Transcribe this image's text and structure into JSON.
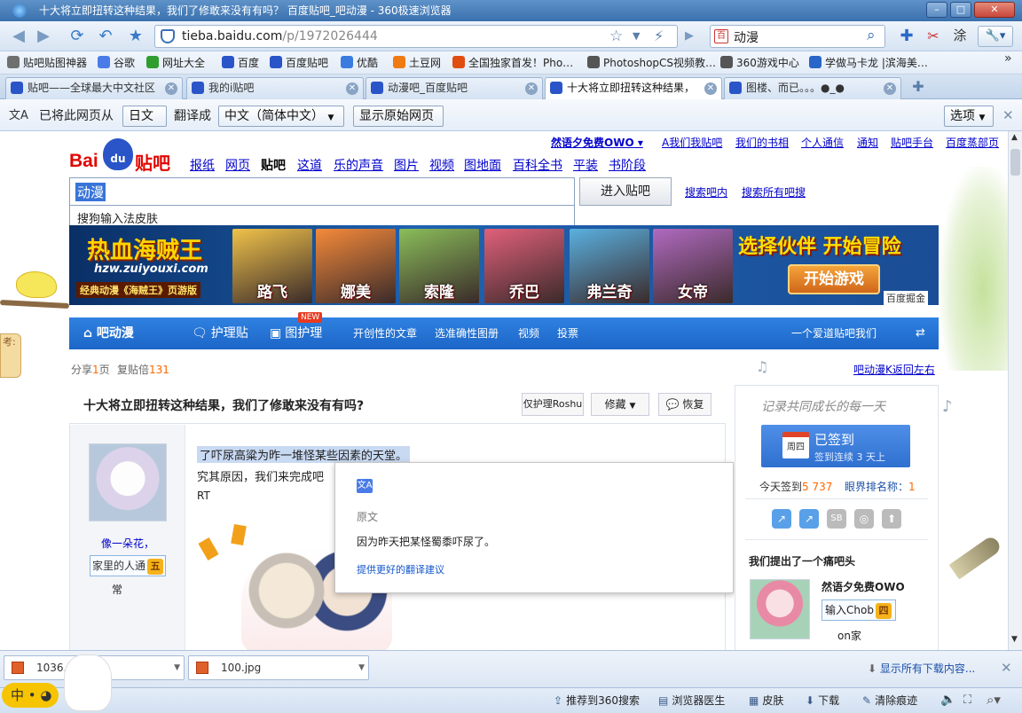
{
  "window": {
    "title": "十大将立即扭转这种结果，我们了修敢来没有有吗？ 百度贴吧_吧动漫 - 360极速浏览器"
  },
  "navbar": {
    "address_host": "tieba.baidu.com",
    "address_path": "/p/1972026444",
    "search_value": "动漫"
  },
  "bookmarks": [
    {
      "label": "贴吧贴图神器",
      "icon": "doc-icon",
      "color": "#6f6f6f"
    },
    {
      "label": "谷歌",
      "icon": "google-icon",
      "color": "#4a7be8"
    },
    {
      "label": "网址大全",
      "icon": "site-nav-icon",
      "color": "#2f9e2f"
    },
    {
      "label": "百度",
      "icon": "baidu-paw-icon",
      "color": "#2a55c8"
    },
    {
      "label": "百度贴吧",
      "icon": "baidu-paw-icon",
      "color": "#2a55c8"
    },
    {
      "label": "优酷",
      "icon": "youku-icon",
      "color": "#3a7be0"
    },
    {
      "label": "土豆网",
      "icon": "tudou-icon",
      "color": "#f07a10"
    },
    {
      "label": "全国独家首发！Pho…",
      "icon": "tmall-icon",
      "color": "#e04d10"
    },
    {
      "label": "PhotoshopCS视频教…",
      "icon": "ps-icon",
      "color": "#555"
    },
    {
      "label": "360游戏中心",
      "icon": "gamepad-icon",
      "color": "#555"
    },
    {
      "label": "学做马卡龙 |滨海美…",
      "icon": "site-icon",
      "color": "#2a65c8"
    }
  ],
  "tabs": [
    {
      "label": "贴吧——全球最大中文社区",
      "active": false
    },
    {
      "label": "我的i贴吧",
      "active": false
    },
    {
      "label": "动漫吧_百度贴吧",
      "active": false
    },
    {
      "label": "十大将立即扭转这种结果，",
      "active": true
    },
    {
      "label": "图楼、而已。。。●_●",
      "active": false
    }
  ],
  "translate_bar": {
    "text1": "已将此网页从",
    "source_lang": "日文",
    "text2": "翻译成",
    "target_lang": "中文（简体中文）",
    "show_original": "显示原始网页",
    "options": "选项"
  },
  "page": {
    "user": "然语夕免费OWO",
    "top_links": [
      "A我们我贴吧",
      "我们的书相",
      "个人通信",
      "通知",
      "贴吧手台",
      "百度蒸部页"
    ],
    "nav_links": [
      "报纸",
      "网页",
      "贴吧",
      "这道",
      "乐的声音",
      "图片",
      "视频",
      "图地面",
      "百科全书",
      "平装",
      "书阶段"
    ],
    "search_value": "动漫",
    "search_suggestion": "搜狗输入法皮肤",
    "enter_button": "进入贴吧",
    "search_in_bar": "搜索吧内",
    "search_all": "搜索所有吧搜",
    "banner": {
      "logo": "热血海贼王",
      "site": "hzw.zuiyouxi.com",
      "subtitle": "经典动漫《海贼王》页游版",
      "chars": [
        "路飞",
        "娜美",
        "索隆",
        "乔巴",
        "弗兰奇",
        "女帝"
      ],
      "slogan": "选择伙伴 开始冒险",
      "start": "开始游戏",
      "sponsor": "百度掘金"
    },
    "bluebar": {
      "home": "吧动漫",
      "items": [
        "护理贴",
        "图护理",
        "开创性的文章",
        "选准确性图册",
        "视频",
        "投票"
      ],
      "new_badge": "NEW",
      "right": "一个爱道贴吧我们"
    },
    "meta": {
      "share_label": "分享",
      "share_count": "1",
      "share_unit": "页",
      "reply_label": "复贴倍",
      "reply_count": "131",
      "back_link": "吧动漫K返回左右"
    },
    "post": {
      "title": "十大将立即扭转这种结果，我们了修敢来没有有吗?",
      "only_owner": "仅护理Roshu",
      "collect": "修藏",
      "reply": "恢复",
      "author": "像一朵花，",
      "author_level_label": "家里的人通",
      "author_level": "五",
      "author_extra": "常",
      "line1": "了吓尿高粱为昨一堆怪某些因素的天堂。",
      "line2": "究其原因，我们来完成吧",
      "line3": "RT"
    },
    "popup": {
      "label": "原文",
      "original": "因为昨天把某怪蜀黍吓尿了。",
      "suggest": "提供更好的翻译建议"
    },
    "sidebar": {
      "motto": "记录共同成长的每一天",
      "sign_day": "周四",
      "sign_title": "已签到",
      "sign_sub": "签到连续 3 天上",
      "today_label": "今天签到",
      "today_count": "5 737",
      "rank_label": "眼界排名称：",
      "rank_value": "1",
      "owner_title": "我们提出了一个痛吧头",
      "owner_name": "然语夕免费OWO",
      "owner_badge_label": "输入Chob",
      "owner_badge_level": "四",
      "owner_status": "on家"
    }
  },
  "downloads": {
    "items": [
      "1036.jp",
      "100.jpg"
    ],
    "show_all": "显示所有下载内容..."
  },
  "statusbar": {
    "ime": "中",
    "items": [
      "推荐到360搜索",
      "浏览器医生",
      "皮肤",
      "下载",
      "清除痕迹"
    ]
  }
}
